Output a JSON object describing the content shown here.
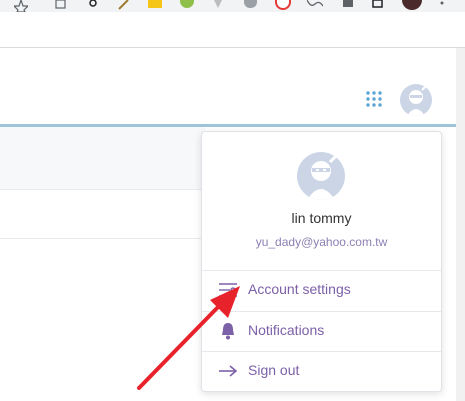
{
  "user": {
    "name": "lin tommy",
    "email": "yu_dady@yahoo.com.tw"
  },
  "menu": {
    "items": [
      {
        "label": "Account settings",
        "icon": "sliders-icon"
      },
      {
        "label": "Notifications",
        "icon": "bell-icon"
      },
      {
        "label": "Sign out",
        "icon": "arrow-right-icon"
      }
    ]
  },
  "colors": {
    "accent_purple": "#7c60a8",
    "email_text": "#8d7fb2",
    "header_line": "#9fc3d8",
    "annotation_arrow": "#e8222a"
  }
}
